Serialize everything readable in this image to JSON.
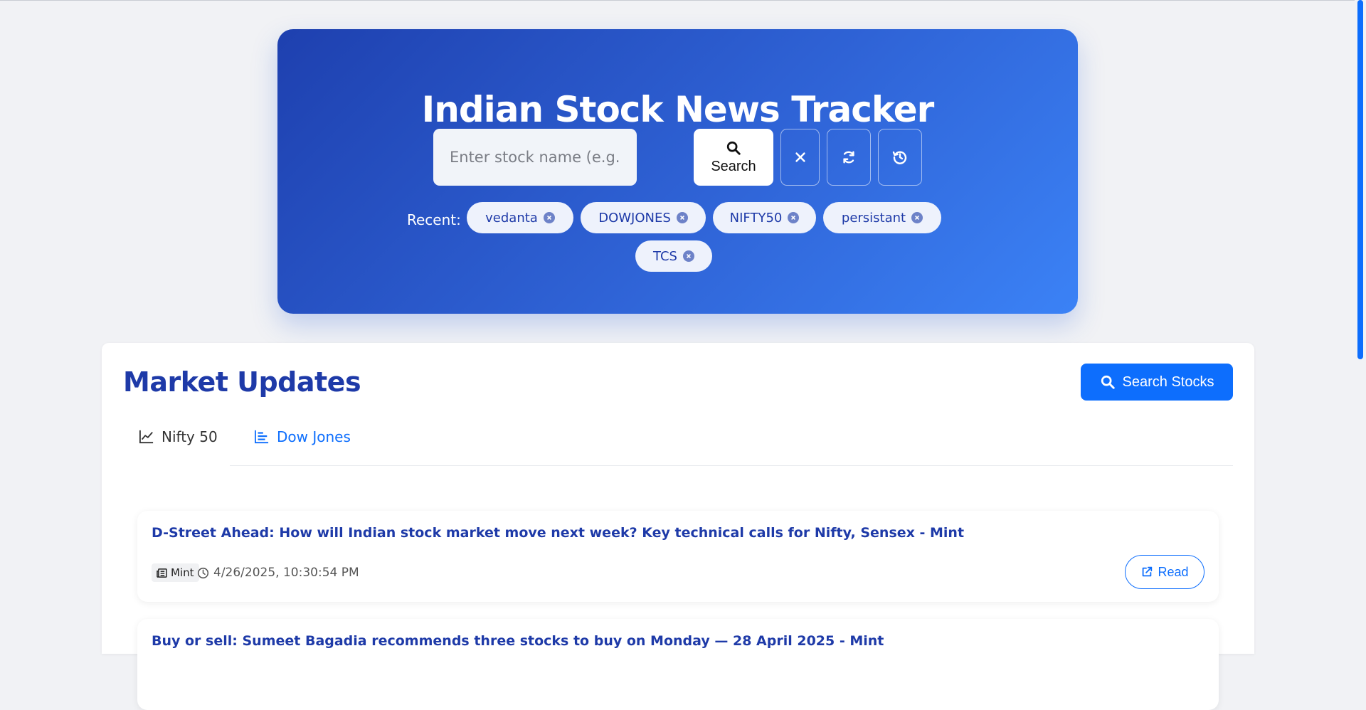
{
  "hero": {
    "title": "Indian Stock News Tracker",
    "search_placeholder": "Enter stock name (e.g., VEDANTA)",
    "search_label": "Search",
    "recent_label": "Recent:",
    "recent": [
      "vedanta",
      "DOWJONES",
      "NIFTY50",
      "persistant",
      "TCS"
    ]
  },
  "main": {
    "title": "Market Updates",
    "search_stocks_label": "Search Stocks",
    "tabs": [
      {
        "label": "Nifty 50",
        "active": false
      },
      {
        "label": "Dow Jones",
        "active": true
      }
    ],
    "news": [
      {
        "title": "D-Street Ahead: How will Indian stock market move next week? Key technical calls for Nifty, Sensex - Mint",
        "source": "Mint",
        "time": "4/26/2025, 10:30:54 PM",
        "read_label": "Read"
      },
      {
        "title": "Buy or sell: Sumeet Bagadia recommends three stocks to buy on Monday — 28 April 2025 - Mint"
      }
    ]
  },
  "colors": {
    "accent": "#0d6efd",
    "heading": "#1e3aa8",
    "hero_gradient": [
      "#1e40af",
      "#3b82f6"
    ]
  }
}
